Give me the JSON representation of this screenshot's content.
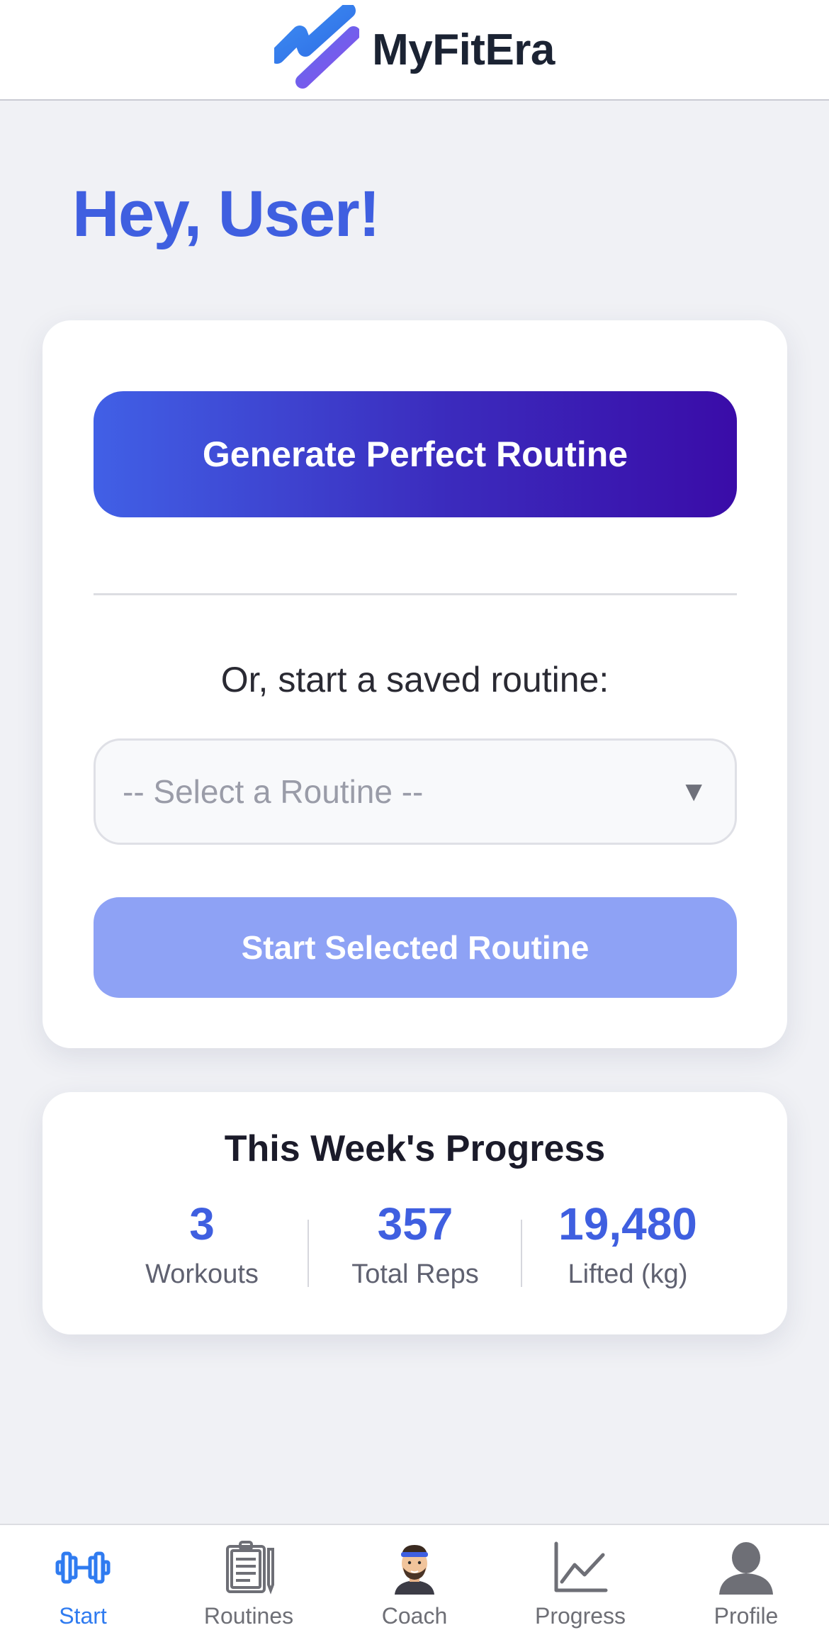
{
  "header": {
    "brand": "MyFitEra",
    "logo_icon": "myfitera-logo-icon"
  },
  "greeting": "Hey, User!",
  "routine_card": {
    "generate_label": "Generate Perfect Routine",
    "or_label": "Or, start a saved routine:",
    "select_placeholder": "-- Select a Routine --",
    "caret": "▼",
    "start_label": "Start Selected Routine"
  },
  "progress": {
    "title": "This Week's Progress",
    "stats": [
      {
        "value": "3",
        "label": "Workouts"
      },
      {
        "value": "357",
        "label": "Total Reps"
      },
      {
        "value": "19,480",
        "label": "Lifted (kg)"
      }
    ]
  },
  "tabs": [
    {
      "label": "Start",
      "icon": "dumbbell-icon",
      "active": true
    },
    {
      "label": "Routines",
      "icon": "clipboard-icon",
      "active": false
    },
    {
      "label": "Coach",
      "icon": "coach-avatar-icon",
      "active": false
    },
    {
      "label": "Progress",
      "icon": "line-chart-icon",
      "active": false
    },
    {
      "label": "Profile",
      "icon": "person-icon",
      "active": false
    }
  ],
  "colors": {
    "accent": "#3f5fe0",
    "gradient_start": "#4160e6",
    "gradient_end": "#3a0ca8",
    "start_button": "#8ea2f5",
    "active_tab": "#2f7bf0",
    "background": "#f0f1f5"
  }
}
